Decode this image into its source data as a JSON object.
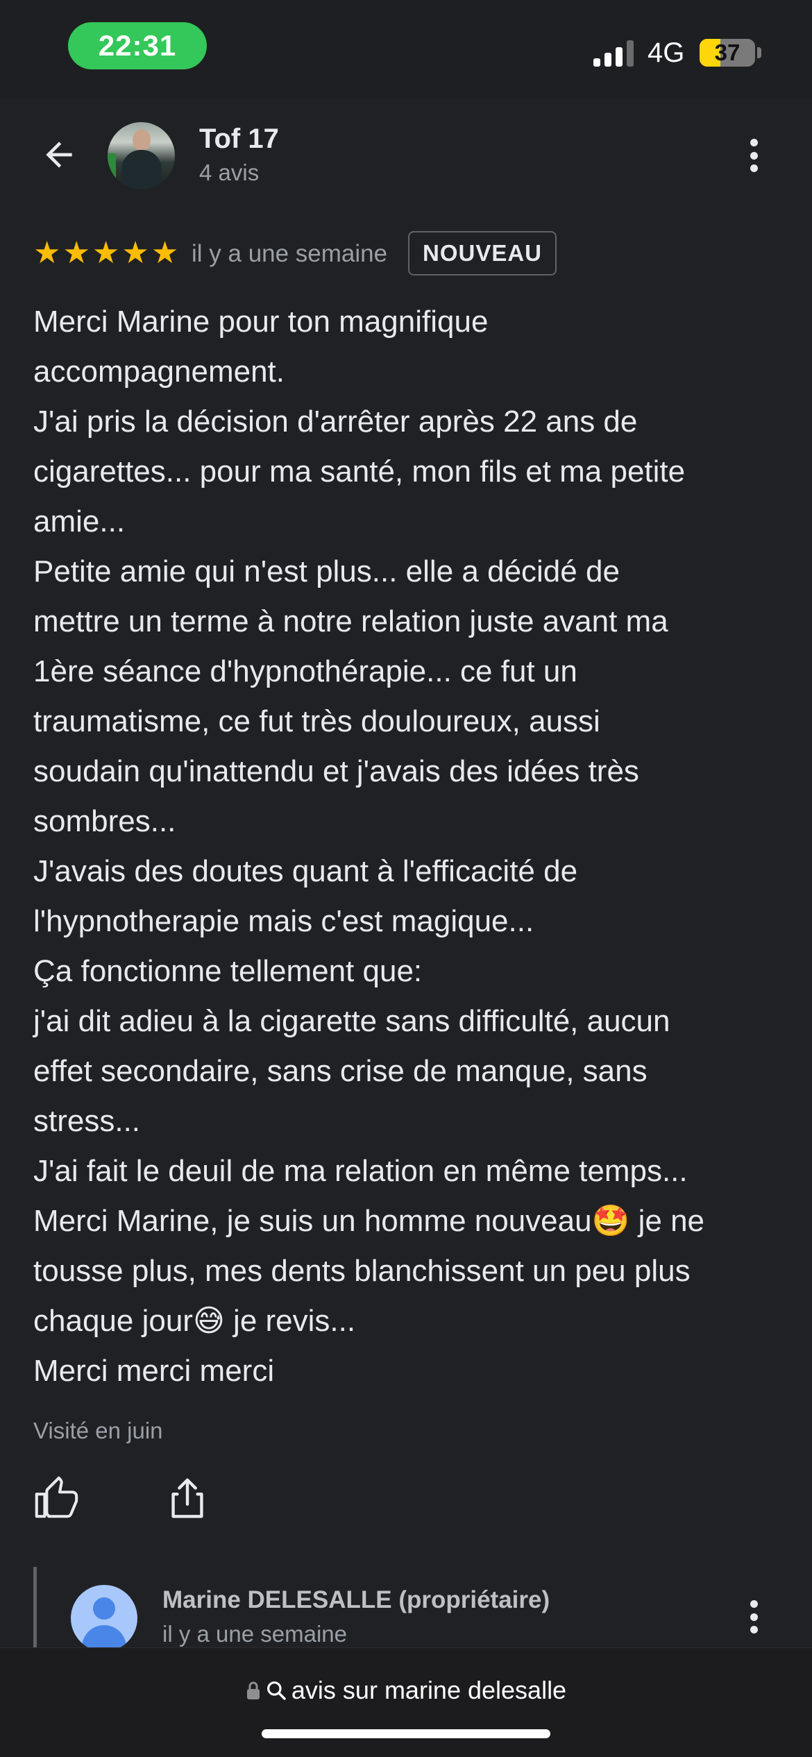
{
  "status_bar": {
    "time": "22:31",
    "network": "4G",
    "battery_level": "37",
    "battery_fraction": 0.37,
    "signal_bars_active": 3,
    "signal_bars_total": 4
  },
  "header": {
    "user_name": "Tof 17",
    "user_reviews": "4 avis"
  },
  "review": {
    "rating_stars": 5,
    "stars": [
      "★",
      "★",
      "★",
      "★",
      "★"
    ],
    "time_ago": "il y a une semaine",
    "badge": "NOUVEAU",
    "lines": [
      "Merci Marine pour ton magnifique",
      "accompagnement.",
      "J'ai pris la décision d'arrêter après 22 ans de",
      "cigarettes... pour ma santé, mon fils et ma petite",
      "amie...",
      "Petite amie qui n'est plus... elle a décidé de",
      "mettre un terme à notre relation juste avant ma",
      "1ère séance d'hypnothérapie... ce fut un",
      "traumatisme, ce fut très douloureux, aussi",
      "soudain qu'inattendu et j'avais des idées très",
      "sombres...",
      "J'avais des doutes quant à l'efficacité de",
      "l'hypnotherapie mais c'est magique...",
      "Ça fonctionne tellement que:",
      "j'ai dit adieu à la cigarette sans difficulté, aucun",
      "effet secondaire, sans crise de manque, sans",
      "stress...",
      "J'ai fait le deuil de ma relation en même temps...",
      "Merci Marine, je suis un homme nouveau🤩 je ne",
      "tousse plus, mes dents blanchissent un peu plus",
      "chaque jour😅 je revis...",
      "Merci merci merci"
    ],
    "visited": "Visité en juin"
  },
  "owner_reply": {
    "name": "Marine DELESALLE (propriétaire)",
    "time_ago": "il y a une semaine"
  },
  "browser": {
    "url_text": "avis sur marine delesalle"
  },
  "icons": {
    "back": "arrow-left-icon",
    "more": "more-vert-icon",
    "like": "thumb-up-icon",
    "share": "share-icon",
    "lock": "lock-icon",
    "search": "search-icon"
  }
}
